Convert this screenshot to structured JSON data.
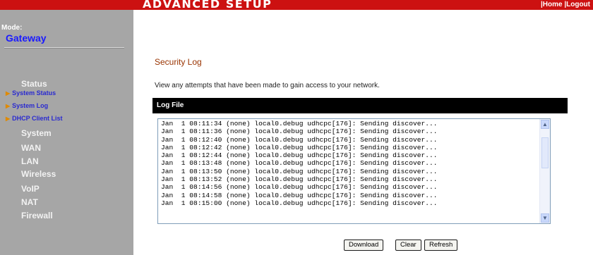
{
  "header": {
    "title": "ADVANCED SETUP",
    "links": [
      "|Home |",
      "Logout"
    ]
  },
  "sidebar": {
    "mode_label": "Mode:",
    "mode_value": "Gateway",
    "sections": [
      {
        "label": "Status",
        "items": [
          {
            "label": "System Status"
          },
          {
            "label": "System Log"
          },
          {
            "label": "DHCP Client List"
          }
        ]
      },
      {
        "label": "System"
      },
      {
        "label": "WAN"
      },
      {
        "label": "LAN"
      },
      {
        "label": "Wireless"
      },
      {
        "label": "VoIP"
      },
      {
        "label": "NAT"
      },
      {
        "label": "Firewall"
      }
    ]
  },
  "main": {
    "page_title": "Security Log",
    "description": "View any attempts that have been made to gain access to your network.",
    "log_header": "Log File",
    "log_lines": [
      "Jan  1 08:11:34 (none) local0.debug udhcpc[176]: Sending discover...",
      "Jan  1 08:11:36 (none) local0.debug udhcpc[176]: Sending discover...",
      "Jan  1 08:12:40 (none) local0.debug udhcpc[176]: Sending discover...",
      "Jan  1 08:12:42 (none) local0.debug udhcpc[176]: Sending discover...",
      "Jan  1 08:12:44 (none) local0.debug udhcpc[176]: Sending discover...",
      "Jan  1 08:13:48 (none) local0.debug udhcpc[176]: Sending discover...",
      "Jan  1 08:13:50 (none) local0.debug udhcpc[176]: Sending discover...",
      "Jan  1 08:13:52 (none) local0.debug udhcpc[176]: Sending discover...",
      "Jan  1 08:14:56 (none) local0.debug udhcpc[176]: Sending discover...",
      "Jan  1 08:14:58 (none) local0.debug udhcpc[176]: Sending discover...",
      "Jan  1 08:15:00 (none) local0.debug udhcpc[176]: Sending discover..."
    ],
    "buttons": {
      "download": "Download",
      "clear": "Clear",
      "refresh": "Refresh"
    }
  },
  "colors": {
    "header_red": "#cc1111",
    "sidebar_gray": "#a6a6a6",
    "title_brown": "#993300",
    "link_blue": "#2a2ad0",
    "arrow_orange": "#e08a00"
  },
  "icons": [
    "triangle-right-icon",
    "scroll-up-arrow-icon",
    "scroll-down-arrow-icon"
  ]
}
